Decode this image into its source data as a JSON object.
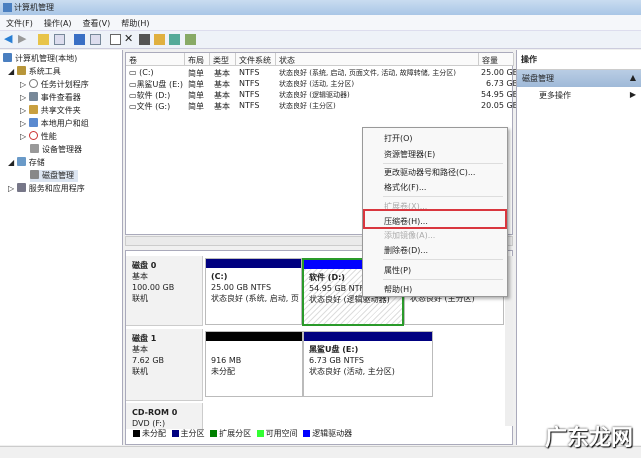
{
  "window": {
    "title": "计算机管理"
  },
  "menu": [
    "文件(F)",
    "操作(A)",
    "查看(V)",
    "帮助(H)"
  ],
  "tree": [
    {
      "label": "计算机管理(本地)",
      "level": 0
    },
    {
      "label": "系统工具",
      "level": 1
    },
    {
      "label": "任务计划程序",
      "level": 2
    },
    {
      "label": "事件查看器",
      "level": 2
    },
    {
      "label": "共享文件夹",
      "level": 2
    },
    {
      "label": "本地用户和组",
      "level": 2
    },
    {
      "label": "性能",
      "level": 2
    },
    {
      "label": "设备管理器",
      "level": 2
    },
    {
      "label": "存储",
      "level": 1
    },
    {
      "label": "磁盘管理",
      "level": 2,
      "selected": true
    },
    {
      "label": "服务和应用程序",
      "level": 1
    }
  ],
  "list": {
    "headers": [
      "卷",
      "布局",
      "类型",
      "文件系统",
      "状态",
      "容量"
    ],
    "rows": [
      [
        "(C:)",
        "简单",
        "基本",
        "NTFS",
        "状态良好 (系统, 启动, 页面文件, 活动, 故障转储, 主分区)",
        "25.00 GB"
      ],
      [
        "黑鲨U盘 (E:)",
        "简单",
        "基本",
        "NTFS",
        "状态良好 (活动, 主分区)",
        "6.73 GB"
      ],
      [
        "软件 (D:)",
        "简单",
        "基本",
        "NTFS",
        "状态良好 (逻辑驱动器)",
        "54.95 GB"
      ],
      [
        "文件 (G:)",
        "简单",
        "基本",
        "NTFS",
        "状态良好 (主分区)",
        "20.05 GB"
      ]
    ]
  },
  "disks": [
    {
      "name": "磁盘 0",
      "type": "基本",
      "size": "100.00 GB",
      "status": "联机",
      "parts": [
        {
          "name": "(C:)",
          "size": "25.00 GB NTFS",
          "status": "状态良好 (系统, 启动, 页",
          "color": "#000080"
        },
        {
          "name": "软件  (D:)",
          "size": "54.95 GB NTFS",
          "status": "状态良好 (逻辑驱动器)",
          "color": "#0000ff"
        },
        {
          "name": "",
          "size": "",
          "status": "状态良好 (主分区)",
          "color": "#000080"
        }
      ]
    },
    {
      "name": "磁盘 1",
      "type": "基本",
      "size": "7.62 GB",
      "status": "联机",
      "parts": [
        {
          "name": "",
          "size": "916 MB",
          "status": "未分配",
          "color": "#000000"
        },
        {
          "name": "黑鲨U盘  (E:)",
          "size": "6.73 GB NTFS",
          "status": "状态良好 (活动, 主分区)",
          "color": "#000080"
        }
      ]
    },
    {
      "name": "CD-ROM 0",
      "type": "DVD (F:)"
    }
  ],
  "legend": [
    {
      "label": "未分配",
      "color": "#000000"
    },
    {
      "label": "主分区",
      "color": "#000080"
    },
    {
      "label": "扩展分区",
      "color": "#008000"
    },
    {
      "label": "可用空间",
      "color": "#33ff33"
    },
    {
      "label": "逻辑驱动器",
      "color": "#0000ff"
    }
  ],
  "actions": {
    "header": "操作",
    "section": "磁盘管理",
    "more": "更多操作"
  },
  "context_menu": [
    {
      "label": "打开(O)"
    },
    {
      "label": "资源管理器(E)"
    },
    {
      "label": "更改驱动器号和路径(C)..."
    },
    {
      "label": "格式化(F)..."
    },
    {
      "label": "扩展卷(X)...",
      "disabled": true
    },
    {
      "label": "压缩卷(H)...",
      "highlighted": true
    },
    {
      "label": "添加镜像(A)...",
      "disabled": true
    },
    {
      "label": "删除卷(D)..."
    },
    {
      "label": "属性(P)"
    },
    {
      "label": "帮助(H)"
    }
  ],
  "watermark": "广东龙网"
}
